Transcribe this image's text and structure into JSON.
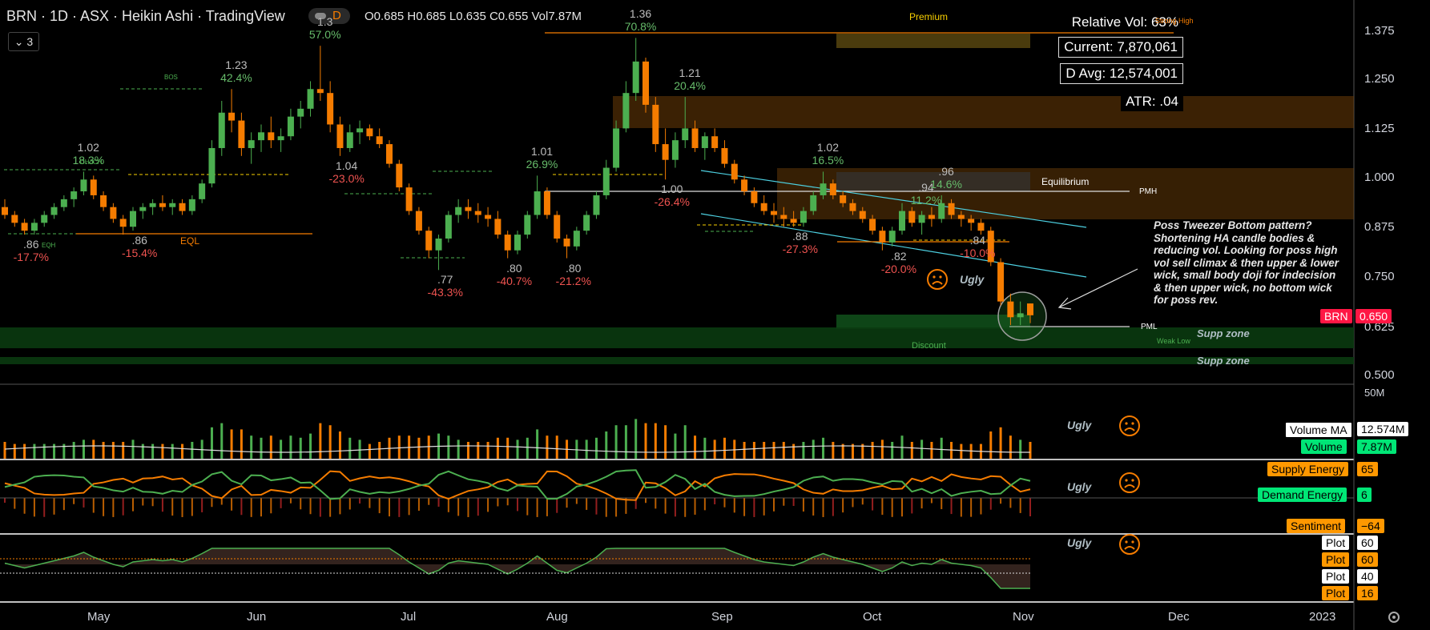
{
  "header": {
    "title": "BRN · 1D · ASX · Heikin Ashi · TradingView",
    "interval_badge": "D",
    "ohlc": "O0.685 H0.685 L0.635 C0.655 Vol7.87M",
    "indicator_count": "3"
  },
  "stats": {
    "relative_vol": "Relative Vol: 63%",
    "current": "Current: 7,870,061",
    "d_avg": "D Avg: 12,574,001",
    "atr": "ATR: .04"
  },
  "annotation": "Poss Tweezer Bottom pattern? Shortening HA candle bodies & reducing vol. Looking for poss high vol sell climax & then upper & lower wick, small body doji for indecision & then upper wick, no bottom wick for poss rev.",
  "zones": {
    "premium": "Premium",
    "strong_high": "Strong High",
    "equilibrium": "Equilibrium",
    "pmh": "PMH",
    "pml": "PML",
    "discount": "Discount",
    "weak_low": "Weak Low",
    "supp1": "Supp zone",
    "supp2": "Supp zone",
    "ugly_main": "Ugly"
  },
  "price_tag": {
    "symbol": "BRN",
    "value": "0.650"
  },
  "right_labels": {
    "volume_ma_name": "Volume MA",
    "volume_ma_value": "12.574M",
    "volume_name": "Volume",
    "volume_value": "7.87M",
    "supply_name": "Supply Energy",
    "supply_value": "65",
    "demand_name": "Demand Energy",
    "demand_value": "6",
    "sentiment_name": "Sentiment",
    "sentiment_value": "−64",
    "plot1_name": "Plot",
    "plot1_value": "60",
    "plot2_name": "Plot",
    "plot2_value": "60",
    "plot3_name": "Plot",
    "plot3_value": "40",
    "plot4_name": "Plot",
    "plot4_value": "16"
  },
  "pane_labels": {
    "ugly1": "Ugly",
    "ugly2": "Ugly",
    "ugly3": "Ugly",
    "vol_scale": "50M"
  },
  "colors": {
    "up": "#4caf50",
    "down": "#f57c00",
    "bg": "#000000",
    "accent": "#ff1744"
  },
  "chart_data": {
    "type": "candlestick",
    "style": "Heikin Ashi",
    "symbol": "BRN",
    "y_ticks": [
      "1.375",
      "1.250",
      "1.125",
      "1.000",
      "0.875",
      "0.750",
      "0.625",
      "0.500"
    ],
    "ylim": [
      0.5,
      1.375
    ],
    "x_ticks": [
      "May",
      "Jun",
      "Jul",
      "Aug",
      "Sep",
      "Oct",
      "Nov",
      "Dec",
      "2023"
    ],
    "swing_labels": [
      {
        "price": ".86",
        "pct": "-17.7%",
        "kind": "low"
      },
      {
        "price": ".86",
        "pct": "-15.4%",
        "kind": "low"
      },
      {
        "price": "1.02",
        "pct": "18.3%",
        "kind": "high"
      },
      {
        "price": "1.23",
        "pct": "42.4%",
        "kind": "high"
      },
      {
        "price": "1.3",
        "pct": "57.0%",
        "kind": "high"
      },
      {
        "price": "1.04",
        "pct": "-23.0%",
        "kind": "low"
      },
      {
        "price": ".77",
        "pct": "-43.3%",
        "kind": "low"
      },
      {
        "price": ".80",
        "pct": "-40.7%",
        "kind": "low"
      },
      {
        "price": "1.01",
        "pct": "26.9%",
        "kind": "high"
      },
      {
        "price": ".80",
        "pct": "-21.2%",
        "kind": "low"
      },
      {
        "price": "1.36",
        "pct": "70.8%",
        "kind": "high"
      },
      {
        "price": "1.21",
        "pct": "20.4%",
        "kind": "high"
      },
      {
        "price": "1.00",
        "pct": "-26.4%",
        "kind": "low"
      },
      {
        "price": ".88",
        "pct": "-27.3%",
        "kind": "low"
      },
      {
        "price": "1.02",
        "pct": "16.5%",
        "kind": "high"
      },
      {
        "price": ".82",
        "pct": "-20.0%",
        "kind": "low"
      },
      {
        "price": ".94",
        "pct": "11.2%",
        "kind": "high"
      },
      {
        "price": ".84",
        "pct": "-10.0%",
        "kind": "low"
      },
      {
        "price": ".96",
        "pct": "14.6%",
        "kind": "high"
      }
    ],
    "structure_labels": [
      "CHoCH",
      "BOS",
      "EQL",
      "EQH"
    ],
    "candles": [
      [
        0.93,
        0.95,
        0.9,
        0.91
      ],
      [
        0.91,
        0.92,
        0.88,
        0.89
      ],
      [
        0.89,
        0.9,
        0.86,
        0.87
      ],
      [
        0.87,
        0.9,
        0.86,
        0.89
      ],
      [
        0.89,
        0.92,
        0.88,
        0.91
      ],
      [
        0.91,
        0.94,
        0.9,
        0.93
      ],
      [
        0.93,
        0.96,
        0.92,
        0.95
      ],
      [
        0.95,
        0.98,
        0.93,
        0.97
      ],
      [
        0.97,
        1.02,
        0.96,
        1.0
      ],
      [
        1.0,
        1.01,
        0.95,
        0.96
      ],
      [
        0.96,
        0.97,
        0.92,
        0.93
      ],
      [
        0.93,
        0.94,
        0.89,
        0.9
      ],
      [
        0.9,
        0.91,
        0.86,
        0.88
      ],
      [
        0.88,
        0.93,
        0.87,
        0.92
      ],
      [
        0.92,
        0.94,
        0.9,
        0.93
      ],
      [
        0.93,
        0.95,
        0.91,
        0.94
      ],
      [
        0.94,
        0.96,
        0.92,
        0.93
      ],
      [
        0.93,
        0.95,
        0.91,
        0.94
      ],
      [
        0.94,
        0.95,
        0.91,
        0.92
      ],
      [
        0.92,
        0.96,
        0.91,
        0.95
      ],
      [
        0.95,
        1.0,
        0.94,
        0.99
      ],
      [
        0.99,
        1.1,
        0.98,
        1.08
      ],
      [
        1.08,
        1.2,
        1.06,
        1.17
      ],
      [
        1.17,
        1.23,
        1.12,
        1.15
      ],
      [
        1.15,
        1.17,
        1.06,
        1.08
      ],
      [
        1.08,
        1.12,
        1.04,
        1.1
      ],
      [
        1.1,
        1.14,
        1.07,
        1.12
      ],
      [
        1.12,
        1.16,
        1.08,
        1.1
      ],
      [
        1.1,
        1.13,
        1.07,
        1.11
      ],
      [
        1.11,
        1.18,
        1.1,
        1.16
      ],
      [
        1.16,
        1.2,
        1.13,
        1.18
      ],
      [
        1.18,
        1.25,
        1.16,
        1.23
      ],
      [
        1.23,
        1.34,
        1.2,
        1.22
      ],
      [
        1.22,
        1.25,
        1.12,
        1.14
      ],
      [
        1.14,
        1.16,
        1.06,
        1.08
      ],
      [
        1.08,
        1.14,
        1.07,
        1.12
      ],
      [
        1.12,
        1.15,
        1.09,
        1.13
      ],
      [
        1.13,
        1.14,
        1.1,
        1.11
      ],
      [
        1.11,
        1.13,
        1.08,
        1.09
      ],
      [
        1.09,
        1.1,
        1.03,
        1.04
      ],
      [
        1.04,
        1.05,
        0.97,
        0.98
      ],
      [
        0.98,
        0.99,
        0.91,
        0.92
      ],
      [
        0.92,
        0.93,
        0.86,
        0.87
      ],
      [
        0.87,
        0.88,
        0.8,
        0.82
      ],
      [
        0.82,
        0.86,
        0.77,
        0.85
      ],
      [
        0.85,
        0.92,
        0.84,
        0.91
      ],
      [
        0.91,
        0.95,
        0.89,
        0.93
      ],
      [
        0.93,
        0.95,
        0.9,
        0.92
      ],
      [
        0.92,
        0.94,
        0.89,
        0.91
      ],
      [
        0.91,
        0.93,
        0.88,
        0.9
      ],
      [
        0.9,
        0.92,
        0.85,
        0.86
      ],
      [
        0.86,
        0.87,
        0.8,
        0.82
      ],
      [
        0.82,
        0.87,
        0.81,
        0.86
      ],
      [
        0.86,
        0.92,
        0.85,
        0.91
      ],
      [
        0.91,
        1.01,
        0.9,
        0.97
      ],
      [
        0.97,
        0.98,
        0.9,
        0.91
      ],
      [
        0.91,
        0.92,
        0.84,
        0.85
      ],
      [
        0.85,
        0.86,
        0.8,
        0.83
      ],
      [
        0.83,
        0.88,
        0.82,
        0.87
      ],
      [
        0.87,
        0.92,
        0.86,
        0.91
      ],
      [
        0.91,
        0.97,
        0.9,
        0.96
      ],
      [
        0.96,
        1.05,
        0.95,
        1.03
      ],
      [
        1.03,
        1.15,
        1.02,
        1.13
      ],
      [
        1.13,
        1.25,
        1.12,
        1.22
      ],
      [
        1.22,
        1.36,
        1.2,
        1.3
      ],
      [
        1.3,
        1.31,
        1.17,
        1.19
      ],
      [
        1.19,
        1.21,
        1.07,
        1.09
      ],
      [
        1.09,
        1.13,
        1.0,
        1.05
      ],
      [
        1.05,
        1.12,
        1.03,
        1.1
      ],
      [
        1.1,
        1.21,
        1.08,
        1.13
      ],
      [
        1.13,
        1.15,
        1.07,
        1.08
      ],
      [
        1.08,
        1.12,
        1.05,
        1.11
      ],
      [
        1.11,
        1.13,
        1.07,
        1.08
      ],
      [
        1.08,
        1.1,
        1.03,
        1.04
      ],
      [
        1.04,
        1.05,
        0.99,
        1.0
      ],
      [
        1.0,
        1.01,
        0.96,
        0.97
      ],
      [
        0.97,
        0.98,
        0.93,
        0.94
      ],
      [
        0.94,
        0.96,
        0.91,
        0.92
      ],
      [
        0.92,
        0.94,
        0.89,
        0.91
      ],
      [
        0.91,
        0.93,
        0.88,
        0.9
      ],
      [
        0.9,
        0.92,
        0.88,
        0.89
      ],
      [
        0.89,
        0.93,
        0.88,
        0.92
      ],
      [
        0.92,
        0.97,
        0.91,
        0.96
      ],
      [
        0.96,
        1.02,
        0.95,
        0.99
      ],
      [
        0.99,
        1.0,
        0.95,
        0.96
      ],
      [
        0.96,
        0.97,
        0.93,
        0.94
      ],
      [
        0.94,
        0.95,
        0.91,
        0.92
      ],
      [
        0.92,
        0.93,
        0.89,
        0.9
      ],
      [
        0.9,
        0.91,
        0.86,
        0.87
      ],
      [
        0.87,
        0.88,
        0.82,
        0.84
      ],
      [
        0.84,
        0.88,
        0.83,
        0.87
      ],
      [
        0.87,
        0.94,
        0.86,
        0.92
      ],
      [
        0.92,
        0.93,
        0.88,
        0.89
      ],
      [
        0.89,
        0.92,
        0.86,
        0.91
      ],
      [
        0.91,
        0.93,
        0.88,
        0.9
      ],
      [
        0.9,
        0.96,
        0.89,
        0.94
      ],
      [
        0.94,
        0.95,
        0.9,
        0.91
      ],
      [
        0.91,
        0.92,
        0.88,
        0.9
      ],
      [
        0.9,
        0.91,
        0.87,
        0.89
      ],
      [
        0.89,
        0.9,
        0.86,
        0.87
      ],
      [
        0.87,
        0.88,
        0.78,
        0.79
      ],
      [
        0.79,
        0.8,
        0.68,
        0.69
      ],
      [
        0.69,
        0.71,
        0.63,
        0.65
      ],
      [
        0.65,
        0.69,
        0.63,
        0.66
      ],
      [
        0.685,
        0.685,
        0.635,
        0.655
      ]
    ]
  }
}
